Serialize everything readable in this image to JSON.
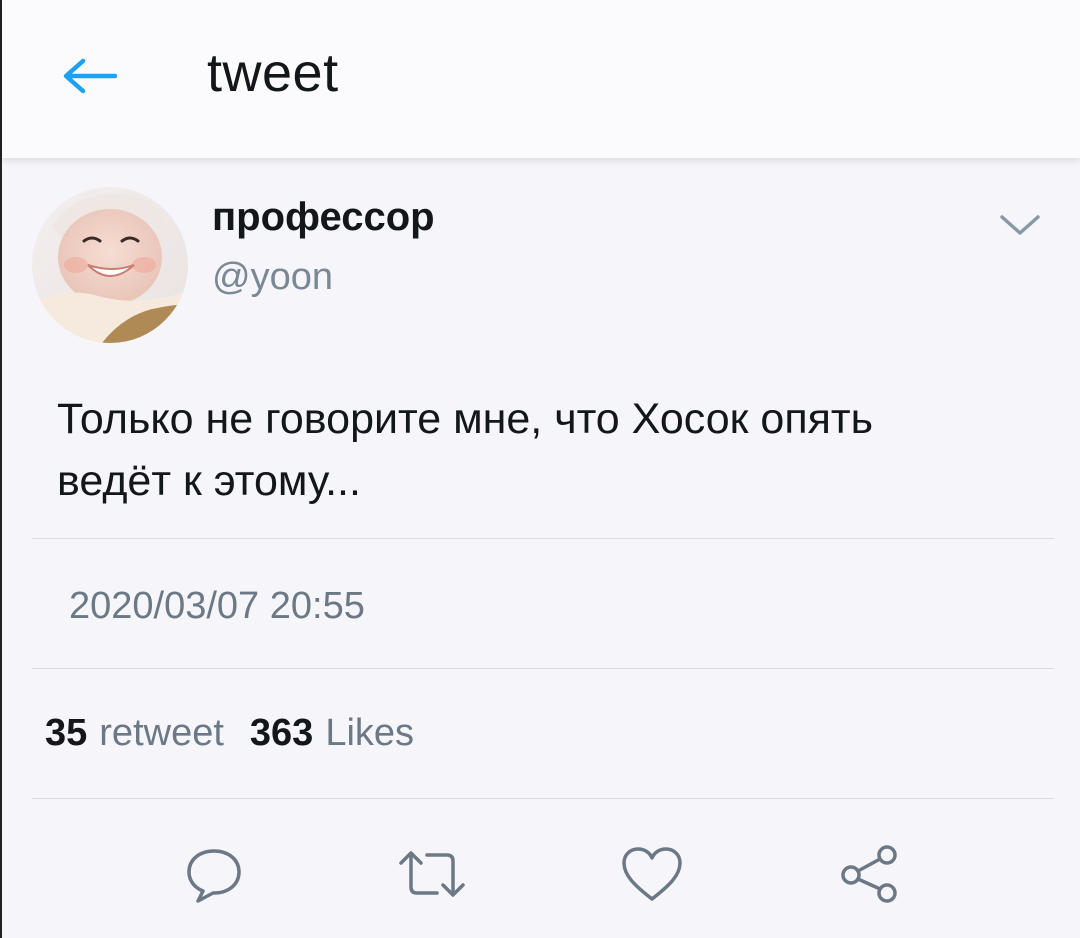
{
  "header": {
    "title": "tweet",
    "back_icon": "arrow-left-icon"
  },
  "tweet": {
    "author_name": "профессор",
    "author_handle": "@yoon",
    "text_line_1": "Только не говорите мне, что Хосок опять",
    "text_line_2": "ведёт к этому...",
    "timestamp": "2020/03/07 20:55"
  },
  "stats": {
    "retweet_count": "35",
    "retweet_label": "retweet",
    "likes_count": "363",
    "likes_label": "Likes"
  },
  "actions": [
    "reply-icon",
    "retweet-icon",
    "like-icon",
    "share-icon"
  ],
  "colors": {
    "accent": "#1da1f2",
    "icon_gray": "#6b7885",
    "text": "#14171a",
    "muted": "#6b7885",
    "background": "#f6f5f9"
  }
}
